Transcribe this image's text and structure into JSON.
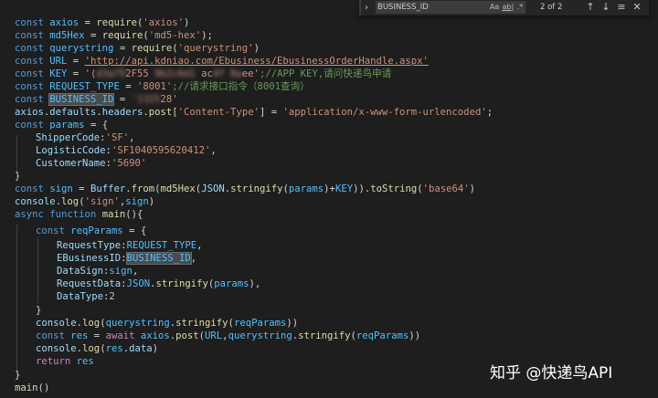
{
  "find_widget": {
    "query": "BUSINESS_ID",
    "match_case_label": "Aa",
    "whole_word_label": "ab|",
    "regex_label": ".*",
    "count": "2 of 2",
    "toggle_icon": "chevron-right-icon",
    "prev_icon": "arrow-up-icon",
    "next_icon": "arrow-down-icon",
    "selection_icon": "find-in-selection-icon",
    "close_icon": "close-icon"
  },
  "code": {
    "l1": [
      "const",
      " ",
      "axios",
      " = ",
      "require",
      "(",
      "'axios'",
      ")"
    ],
    "l2": [
      "const",
      " ",
      "md5Hex",
      " = ",
      "require",
      "(",
      "'md5-hex'",
      ");"
    ],
    "l3": [
      "const",
      " ",
      "querystring",
      " = ",
      "require",
      "(",
      "'querystring'",
      ")"
    ],
    "l4": [
      "const",
      " ",
      "URL",
      " = ",
      "'http://api.kdniao.com/Ebusiness/EbusinessOrderHandle.aspx'"
    ],
    "l5": [
      "const",
      " ",
      "KEY",
      " = ",
      "'(",
      "2F55",
      "ac",
      "ee'",
      ";//APP KEY,请问快递鸟申请"
    ],
    "l6": [
      "const",
      " ",
      "REQUEST_TYPE",
      " = ",
      "'8001'",
      ";//请求接口指令（8001查询）"
    ],
    "l7": [
      "const",
      " ",
      "BUSINESS_ID",
      " = ",
      "28'"
    ],
    "l8": [
      "axios",
      ".",
      "defaults",
      ".",
      "headers",
      ".",
      "post",
      "[",
      "'Content-Type'",
      "] = ",
      "'application/x-www-form-urlencoded'",
      ";"
    ],
    "l9": [
      "const",
      " ",
      "params",
      " = {"
    ],
    "l10": [
      "ShipperCode",
      ":",
      "'SF'",
      ","
    ],
    "l11": [
      "LogisticCode",
      ":",
      "'SF1040595620412'",
      ","
    ],
    "l12": [
      "CustomerName",
      ":",
      "'5690'"
    ],
    "l13": [
      "}"
    ],
    "l14": [
      "const",
      " ",
      "sign",
      " = ",
      "Buffer",
      ".",
      "from",
      "(",
      "md5Hex",
      "(",
      "JSON",
      ".",
      "stringify",
      "(",
      "params",
      ")+",
      "KEY",
      ")).",
      "toString",
      "(",
      "'base64'",
      ")"
    ],
    "l15": [
      "console",
      ".",
      "log",
      "(",
      "'sign'",
      ",",
      "sign",
      ")"
    ],
    "l16": [
      "async",
      " ",
      "function",
      " ",
      "main",
      "(){"
    ],
    "l17": [
      "const",
      " ",
      "reqParams",
      " = {"
    ],
    "l18": [
      "RequestType",
      ":",
      "REQUEST_TYPE",
      ","
    ],
    "l19": [
      "EBusinessID",
      ":",
      "BUSINESS_ID",
      ","
    ],
    "l20": [
      "DataSign",
      ":",
      "sign",
      ","
    ],
    "l21": [
      "RequestData",
      ":",
      "JSON",
      ".",
      "stringify",
      "(",
      "params",
      "),"
    ],
    "l22": [
      "DataType",
      ":",
      "2"
    ],
    "l23": [
      "}"
    ],
    "l24": [
      "console",
      ".",
      "log",
      "(",
      "querystring",
      ".",
      "stringify",
      "(",
      "reqParams",
      "))"
    ],
    "l25": [
      "const",
      " ",
      "res",
      " = ",
      "await",
      " ",
      "axios",
      ".",
      "post",
      "(",
      "URL",
      ",",
      "querystring",
      ".",
      "stringify",
      "(",
      "reqParams",
      "))"
    ],
    "l26": [
      "console",
      ".",
      "log",
      "(",
      "res",
      ".",
      "data",
      ")"
    ],
    "l27": [
      "return",
      " ",
      "res"
    ],
    "l28": [
      "}"
    ],
    "l29": [
      "main",
      "()"
    ]
  },
  "watermark": "知乎 @快递鸟API"
}
